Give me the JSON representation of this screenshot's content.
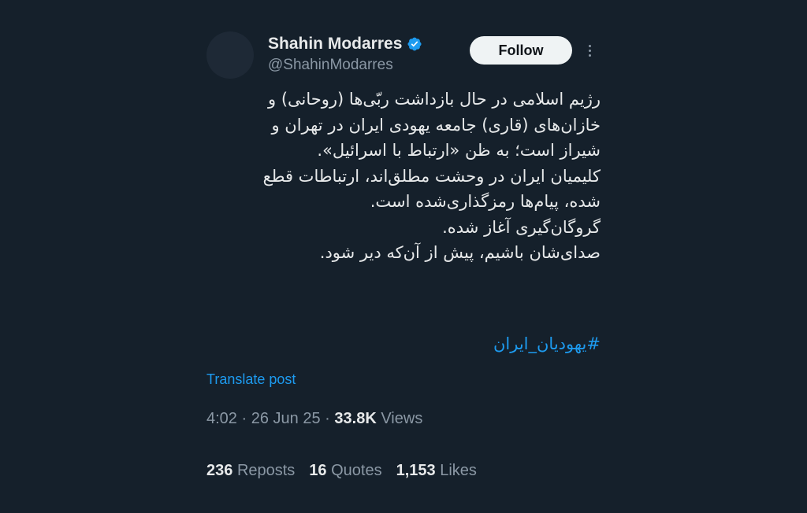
{
  "author": {
    "display_name": "Shahin Modarres",
    "handle": "@ShahinModarres",
    "verified_icon": "verified-badge-icon",
    "avatar_color": "#1e2936"
  },
  "follow_label": "Follow",
  "more_icon": "more-vertical-icon",
  "tweet": {
    "lines": [
      "رژیم اسلامی در حال بازداشت ربّی‌ها (روحانی) و",
      "خازان‌های (قاری) جامعه یهودی ایران در تهران و",
      "شیراز است؛ به ظن «ارتباط با اسرائیل».",
      "کلیمیان ایران در وحشت مطلق‌اند، ارتباطات قطع",
      "شده، پیام‌ها رمزگذاری‌شده است.",
      "گروگان‌گیری آغاز شده.",
      "صدای‌شان باشیم، پیش از آن‌که دیر شود."
    ],
    "hashtag": "#یهودیان_ایران"
  },
  "translate_label": "Translate post",
  "meta": {
    "time": "4:02",
    "separator": "·",
    "date": "26 Jun 25",
    "views_count": "33.8K",
    "views_label": "Views"
  },
  "stats": {
    "reposts_count": "236",
    "reposts_label": "Reposts",
    "quotes_count": "16",
    "quotes_label": "Quotes",
    "likes_count": "1,153",
    "likes_label": "Likes"
  },
  "colors": {
    "background": "#15202b",
    "accent": "#1d9bf0",
    "text_primary": "#e7e9ea",
    "text_secondary": "#8b98a5"
  }
}
